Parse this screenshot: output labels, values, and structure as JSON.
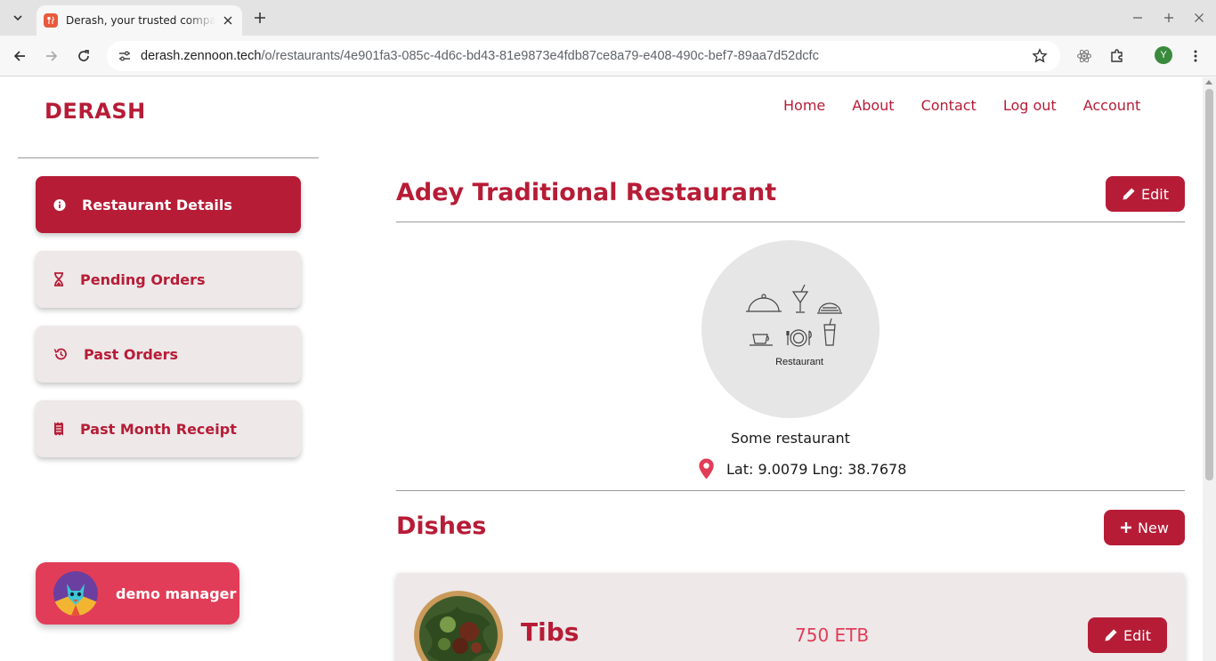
{
  "browser": {
    "tab_title": "Derash, your trusted companion",
    "url_host": "derash.zennoon.tech",
    "url_path": "/o/restaurants/4e901fa3-085c-4d6c-bd43-81e9873e4fdb87ce8a79-e408-490c-bef7-89aa7d52dcfc",
    "profile_initial": "Y"
  },
  "header": {
    "brand": "DERASH",
    "nav": [
      "Home",
      "About",
      "Contact",
      "Log out",
      "Account"
    ]
  },
  "sidebar": {
    "items": [
      {
        "label": "Restaurant Details",
        "icon": "info-circle-icon",
        "active": true
      },
      {
        "label": "Pending Orders",
        "icon": "hourglass-icon",
        "active": false
      },
      {
        "label": "Past Orders",
        "icon": "history-icon",
        "active": false
      },
      {
        "label": "Past Month Receipt",
        "icon": "receipt-icon",
        "active": false
      }
    ],
    "user": {
      "name": "demo manager"
    }
  },
  "restaurant": {
    "name": "Adey Traditional Restaurant",
    "edit_label": "Edit",
    "image_caption": "Restaurant",
    "description": "Some restaurant",
    "location": "Lat: 9.0079 Lng: 38.7678"
  },
  "dishes": {
    "title": "Dishes",
    "new_label": "New",
    "items": [
      {
        "name": "Tibs",
        "price": "750 ETB",
        "edit_label": "Edit"
      }
    ]
  },
  "colors": {
    "primary": "#b71c36",
    "accent": "#e23d58",
    "card": "#eee8e9"
  }
}
